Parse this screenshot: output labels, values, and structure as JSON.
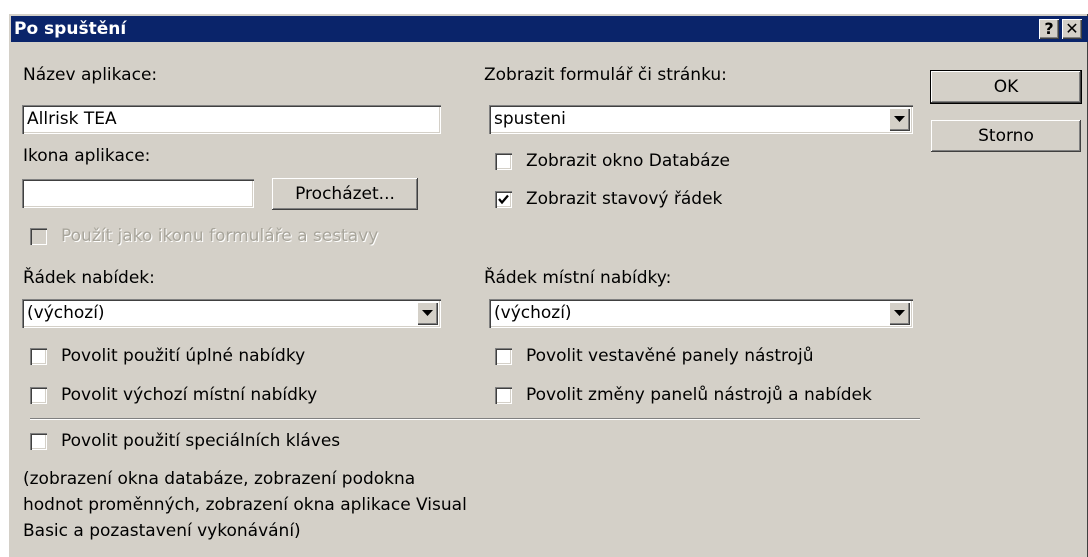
{
  "dialog": {
    "title": "Po spuštění",
    "help_label": "?",
    "close_label": "✕"
  },
  "app_name": {
    "label": "Název aplikace:",
    "value": "Allrisk TEA"
  },
  "app_icon": {
    "label": "Ikona aplikace:",
    "value": "",
    "browse_label": "Procházet..."
  },
  "use_as_form_icon": {
    "label": "Použít jako ikonu formuláře a sestavy",
    "checked": false,
    "disabled": true
  },
  "display_form": {
    "label": "Zobrazit formulář či stránku:",
    "value": "spusteni"
  },
  "show_db_window": {
    "label": "Zobrazit okno Databáze",
    "checked": false
  },
  "show_status_bar": {
    "label": "Zobrazit stavový řádek",
    "checked": true
  },
  "menu_bar": {
    "label": "Řádek nabídek:",
    "value": "(výchozí)"
  },
  "shortcut_menu_bar": {
    "label": "Řádek místní nabídky:",
    "value": "(výchozí)"
  },
  "checkboxes": {
    "allow_full_menus": {
      "label": "Povolit použití úplné nabídky",
      "checked": false
    },
    "allow_default_shortcut_menus": {
      "label": "Povolit výchozí místní nabídky",
      "checked": false
    },
    "allow_builtin_toolbars": {
      "label": "Povolit vestavěné panely nástrojů",
      "checked": false
    },
    "allow_toolbar_menu_changes": {
      "label": "Povolit změny panelů nástrojů a nabídek",
      "checked": false
    },
    "use_special_keys": {
      "label": "Povolit použití speciálních kláves",
      "checked": false
    }
  },
  "special_keys_note": {
    "line1": "(zobrazení okna databáze, zobrazení podokna",
    "line2": "hodnot proměnných, zobrazení okna aplikace Visual",
    "line3": "Basic a pozastavení vykonávání)"
  },
  "buttons": {
    "ok": "OK",
    "cancel": "Storno"
  }
}
